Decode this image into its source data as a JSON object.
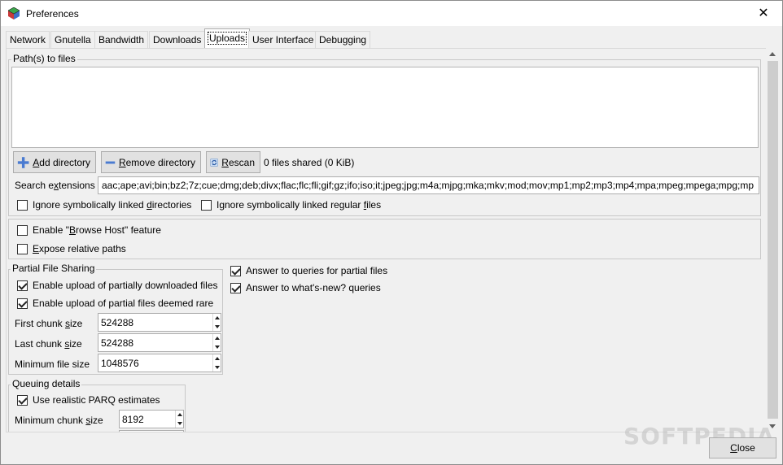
{
  "window": {
    "title": "Preferences",
    "close_glyph": "✕"
  },
  "tabs": [
    {
      "label": "Network"
    },
    {
      "label": "Gnutella"
    },
    {
      "label": "Bandwidth"
    },
    {
      "label": "Downloads"
    },
    {
      "label": "Uploads",
      "active": true
    },
    {
      "label": "User Interface"
    },
    {
      "label": "Debugging"
    }
  ],
  "paths_group": {
    "label": "Path(s) to files",
    "add_directory": {
      "prefix": "",
      "mnemonic": "A",
      "rest": "dd directory"
    },
    "remove_directory": {
      "prefix": "",
      "mnemonic": "R",
      "rest": "emove directory"
    },
    "rescan": {
      "prefix": "",
      "mnemonic": "R",
      "rest": "escan"
    },
    "files_shared": "0 files shared (0 KiB)",
    "search_extensions": {
      "pre": "Search e",
      "mnemonic": "x",
      "post": "tensions"
    },
    "extensions_value": "aac;ape;avi;bin;bz2;7z;cue;dmg;deb;divx;flac;flc;fli;gif;gz;ifo;iso;it;jpeg;jpg;m4a;mjpg;mka;mkv;mod;mov;mp1;mp2;mp3;mp4;mpa;mpeg;mpega;mpg;mp",
    "ignore_dirs": {
      "pre": "Ignore symbolically linked ",
      "mnemonic": "d",
      "post": "irectories",
      "checked": false
    },
    "ignore_files": {
      "pre": "Ignore symbolically linked regular ",
      "mnemonic": "f",
      "post": "iles",
      "checked": false
    }
  },
  "browse_group": {
    "browse_host": {
      "pre": "Enable \"",
      "mnemonic": "B",
      "post": "rowse Host\" feature",
      "checked": false
    },
    "expose_paths": {
      "pre": "",
      "mnemonic": "E",
      "post": "xpose relative paths",
      "checked": false
    }
  },
  "partial_group": {
    "label": "Partial File Sharing",
    "enable_partial": {
      "label": "Enable upload of partially downloaded files",
      "checked": true
    },
    "enable_rare": {
      "label": "Enable upload of partial files deemed rare",
      "checked": true
    },
    "first_chunk": {
      "pre": "First chunk ",
      "mnemonic": "s",
      "post": "ize",
      "value": "524288"
    },
    "last_chunk": {
      "pre": "Last chunk ",
      "mnemonic": "s",
      "post": "ize",
      "value": "524288"
    },
    "min_file": {
      "label": "Minimum file size",
      "value": "1048576"
    }
  },
  "answers": {
    "partial_queries": {
      "label": "Answer to queries for partial files",
      "checked": true
    },
    "whats_new": {
      "label": "Answer to what's-new? queries",
      "checked": true
    }
  },
  "queuing_group": {
    "label": "Queuing details",
    "realistic_parq": {
      "label": "Use realistic PARQ estimates",
      "checked": true
    },
    "min_chunk": {
      "pre": "Minimum chunk ",
      "mnemonic": "s",
      "post": "ize",
      "value": "8192"
    }
  },
  "footer": {
    "close_mnemonic": "C",
    "close_rest": "lose"
  },
  "watermark": "SOFTPEDIA",
  "colors": {
    "window_bg": "#f0f0f0",
    "button_bg": "#e1e1e1",
    "border": "#adadad"
  }
}
